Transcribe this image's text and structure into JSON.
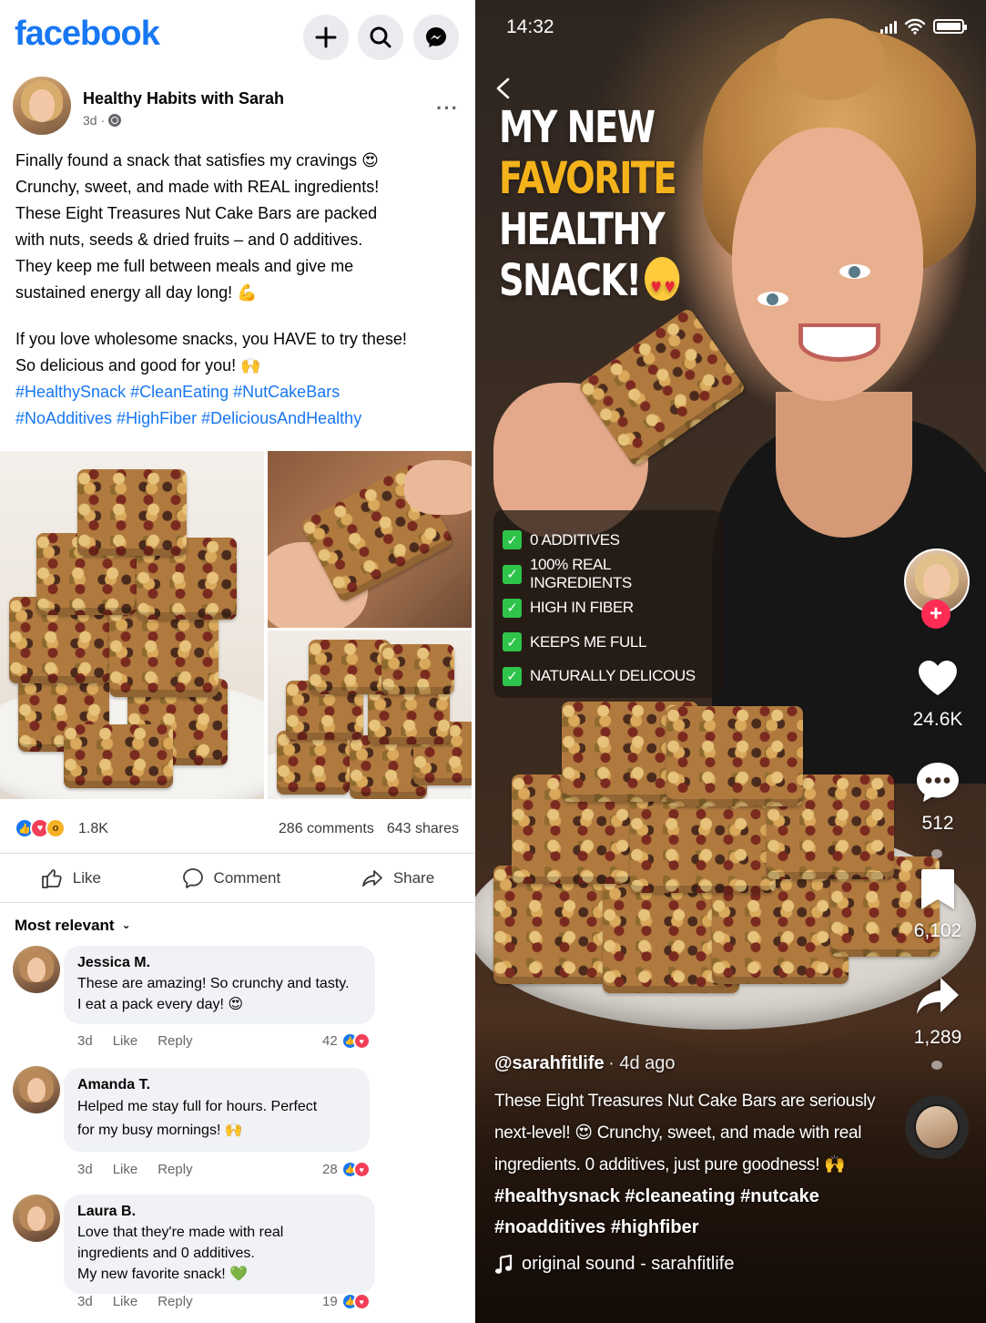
{
  "facebook": {
    "logo": "facebook",
    "post": {
      "author": "Healthy Habits with Sarah",
      "time": "3d",
      "text_lines": [
        "Finally found a snack that satisfies my cravings 😍",
        "Crunchy, sweet, and made with REAL ingredients!",
        "These Eight Treasures Nut Cake Bars are packed",
        "with nuts, seeds & dried fruits – and 0 additives.",
        "They keep me full between meals and give me",
        "sustained energy all day long! 💪"
      ],
      "text2_lines": [
        "If you love wholesome snacks, you HAVE to try these!",
        "So delicious and good for you! 🙌"
      ],
      "hashtag_lines": [
        "#HealthySnack #CleanEating #NutCakeBars",
        "#NoAdditives #HighFiber #DeliciousAndHealthy"
      ]
    },
    "reactions": {
      "count": "1.8K",
      "comments": "286 comments",
      "shares": "643 shares"
    },
    "actions": {
      "like": "Like",
      "comment": "Comment",
      "share": "Share"
    },
    "sort_label": "Most relevant",
    "comments": [
      {
        "name": "Jessica M.",
        "lines": [
          "These are amazing! So crunchy and tasty.",
          "I eat a pack every day! 😍"
        ],
        "time": "3d",
        "like": "Like",
        "reply": "Reply",
        "reacts": "42"
      },
      {
        "name": "Amanda T.",
        "lines": [
          "Helped me stay full for hours. Perfect",
          "for my busy mornings! 🙌"
        ],
        "time": "3d",
        "like": "Like",
        "reply": "Reply",
        "reacts": "28"
      },
      {
        "name": "Laura B.",
        "lines": [
          "Love that they're made with real",
          "ingredients and 0 additives.",
          "My new favorite snack! 💚"
        ],
        "time": "3d",
        "like": "Like",
        "reply": "Reply",
        "reacts": "19"
      }
    ],
    "colors": {
      "brand": "#1877f2",
      "love": "#f33e58"
    }
  },
  "tiktok": {
    "status": {
      "time": "14:32"
    },
    "headline": {
      "line1": "MY NEW",
      "line2": "FAVORITE",
      "line3": "HEALTHY",
      "line4": "SNACK!"
    },
    "checklist": [
      "0 ADDITIVES",
      "100% REAL INGREDIENTS",
      "HIGH IN FIBER",
      "KEEPS ME FULL",
      "NATURALLY DELICOUS"
    ],
    "likes": "24.6K",
    "comments": "512",
    "saves": "6,102",
    "shares": "1,289",
    "caption": {
      "user": "@sarahfitlife",
      "time": "· 4d ago",
      "text_lines": [
        "These Eight Treasures Nut Cake Bars are seriously",
        "next-level! 😍 Crunchy, sweet, and made with real",
        "ingredients. 0 additives, just pure goodness! 🙌"
      ],
      "tag_lines": [
        "#healthysnack #cleaneating #nutcake",
        "#noadditives #highfiber"
      ],
      "sound": "original sound - sarahfitlife"
    },
    "colors": {
      "accent": "#f5b31b",
      "check": "#2ec44a",
      "follow": "#fe2c55"
    }
  }
}
